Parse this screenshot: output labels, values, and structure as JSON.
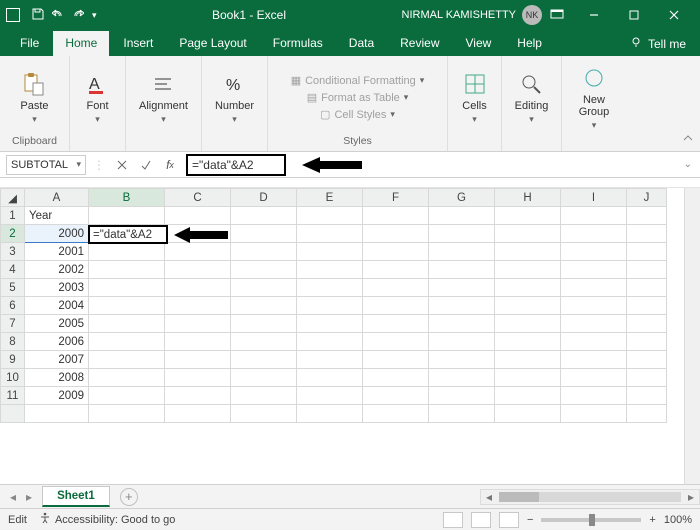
{
  "title": "Book1 - Excel",
  "user": {
    "name": "NIRMAL KAMISHETTY",
    "initials": "NK"
  },
  "tabs": [
    "File",
    "Home",
    "Insert",
    "Page Layout",
    "Formulas",
    "Data",
    "Review",
    "View",
    "Help"
  ],
  "activeTab": "Home",
  "tellme": "Tell me",
  "ribbon": {
    "clipboard": {
      "label": "Clipboard",
      "paste": "Paste"
    },
    "font": {
      "label": "Font",
      "btn": "Font"
    },
    "alignment": {
      "label": "Alignment",
      "btn": "Alignment"
    },
    "number": {
      "label": "Number",
      "btn": "Number"
    },
    "styles": {
      "label": "Styles",
      "cond": "Conditional Formatting",
      "table": "Format as Table",
      "cell": "Cell Styles"
    },
    "cells": {
      "label": "Cells",
      "btn": "Cells"
    },
    "editing": {
      "label": "Editing",
      "btn": "Editing"
    },
    "newgroup": {
      "label": "New Group",
      "btn": "New\nGroup"
    }
  },
  "namebox": "SUBTOTAL",
  "formula": "=\"data\"&A2",
  "columns": [
    "A",
    "B",
    "C",
    "D",
    "E",
    "F",
    "G",
    "H",
    "I",
    "J"
  ],
  "rows": [
    {
      "n": 1,
      "A": "Year"
    },
    {
      "n": 2,
      "A": "2000",
      "B": "=\"data\"&A2"
    },
    {
      "n": 3,
      "A": "2001"
    },
    {
      "n": 4,
      "A": "2002"
    },
    {
      "n": 5,
      "A": "2003"
    },
    {
      "n": 6,
      "A": "2004"
    },
    {
      "n": 7,
      "A": "2005"
    },
    {
      "n": 8,
      "A": "2006"
    },
    {
      "n": 9,
      "A": "2007"
    },
    {
      "n": 10,
      "A": "2008"
    },
    {
      "n": 11,
      "A": "2009"
    }
  ],
  "activeCell": {
    "ref": "B2",
    "value": "=\"data\"&A2"
  },
  "sheetTab": "Sheet1",
  "status": {
    "mode": "Edit",
    "accessibility": "Accessibility: Good to go",
    "zoom": "100%"
  }
}
